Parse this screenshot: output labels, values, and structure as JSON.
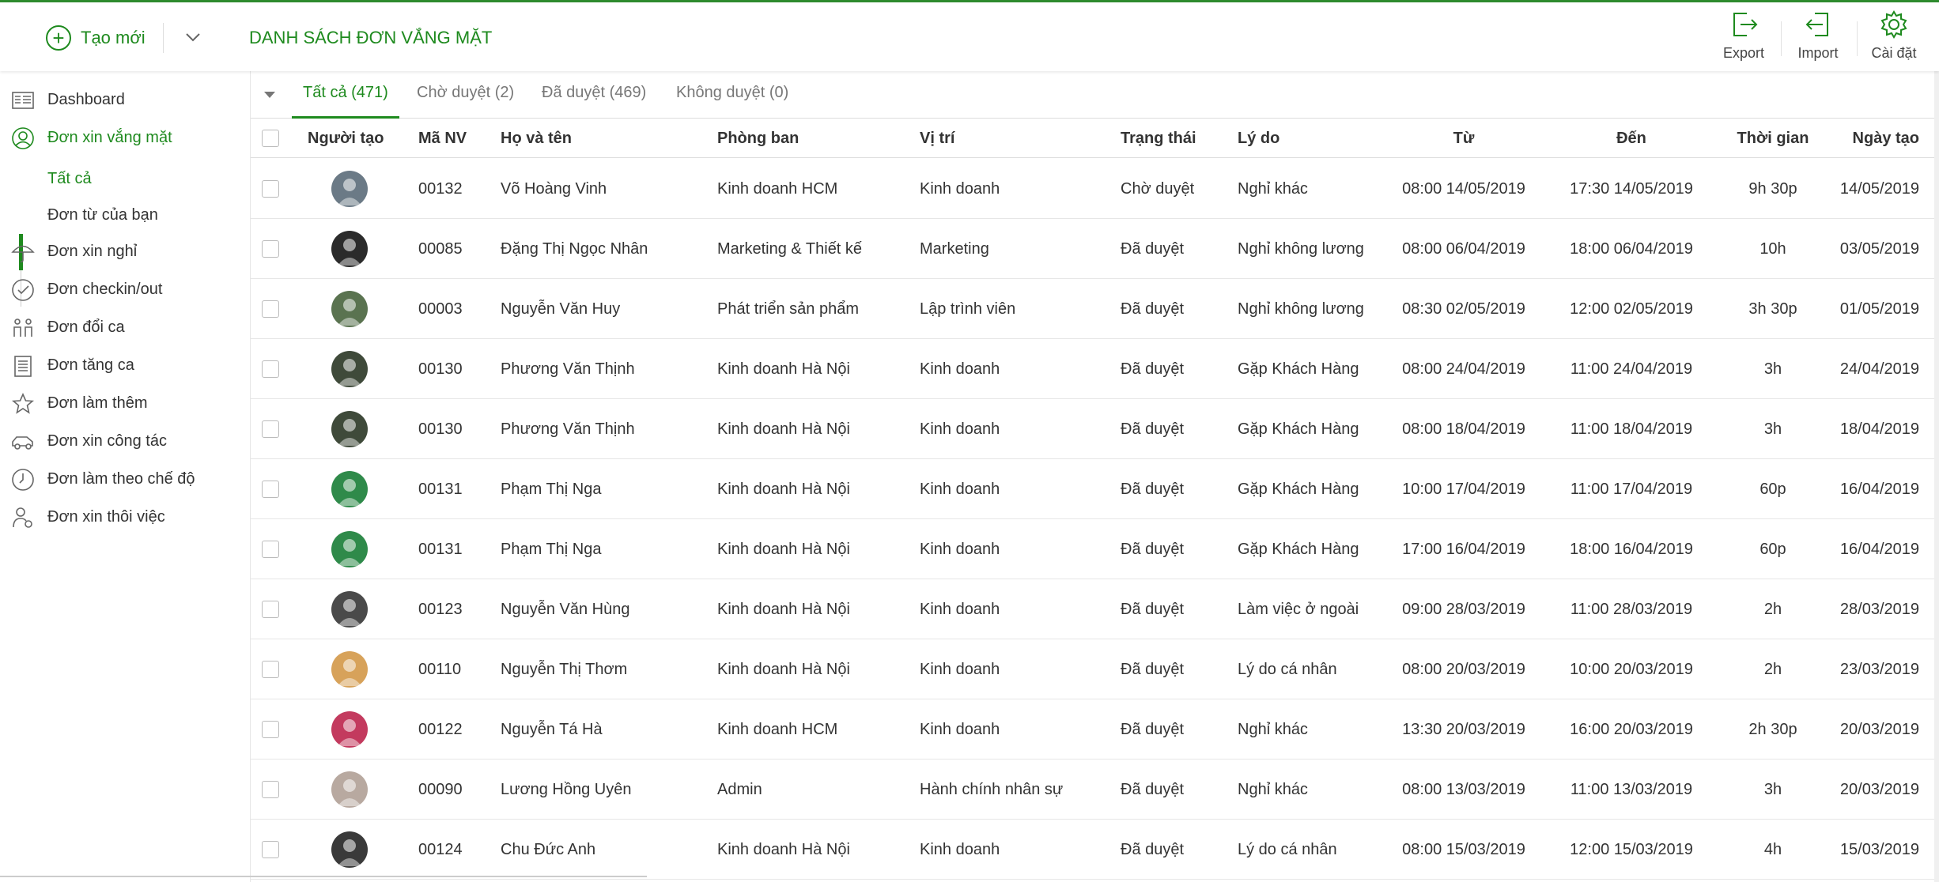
{
  "header": {
    "create_label": "Tạo mới",
    "title": "DANH SÁCH ĐƠN VẮNG MẶT",
    "export_label": "Export",
    "import_label": "Import",
    "settings_label": "Cài đặt",
    "accent_color": "#1e8a1e"
  },
  "sidebar": {
    "items": [
      {
        "label": "Dashboard",
        "icon": "dashboard-icon"
      },
      {
        "label": "Đơn xin vắng mặt",
        "icon": "user-circle-icon",
        "active": true
      },
      {
        "label": "Đơn xin nghỉ",
        "icon": "umbrella-icon"
      },
      {
        "label": "Đơn checkin/out",
        "icon": "check-circle-icon"
      },
      {
        "label": "Đơn đổi ca",
        "icon": "people-swap-icon"
      },
      {
        "label": "Đơn tăng ca",
        "icon": "list-document-icon"
      },
      {
        "label": "Đơn làm thêm",
        "icon": "star-icon"
      },
      {
        "label": "Đơn xin công tác",
        "icon": "car-icon"
      },
      {
        "label": "Đơn làm theo chế độ",
        "icon": "clock-icon"
      },
      {
        "label": "Đơn xin thôi việc",
        "icon": "user-leave-icon"
      }
    ],
    "sub_items": [
      {
        "label": "Tất cả",
        "active": true
      },
      {
        "label": "Đơn từ của bạn"
      }
    ]
  },
  "tabs": [
    {
      "label": "Tất cả (471)",
      "active": true
    },
    {
      "label": "Chờ duyệt (2)"
    },
    {
      "label": "Đã duyệt (469)"
    },
    {
      "label": "Không duyệt (0)"
    }
  ],
  "table": {
    "columns": [
      "Người tạo",
      "Mã NV",
      "Họ và tên",
      "Phòng ban",
      "Vị trí",
      "Trạng thái",
      "Lý do",
      "Từ",
      "Đến",
      "Thời gian",
      "Ngày tạo"
    ],
    "rows": [
      {
        "avatar_color": "#6b7a86",
        "code": "00132",
        "name": "Võ Hoàng Vinh",
        "dept": "Kinh doanh HCM",
        "position": "Kinh doanh",
        "status": "Chờ duyệt",
        "reason": "Nghỉ khác",
        "from": "08:00 14/05/2019",
        "to": "17:30 14/05/2019",
        "duration": "9h 30p",
        "created": "14/05/2019"
      },
      {
        "avatar_color": "#2b2b2b",
        "code": "00085",
        "name": "Đặng Thị Ngọc Nhân",
        "dept": "Marketing & Thiết kế",
        "position": "Marketing",
        "status": "Đã duyệt",
        "reason": "Nghỉ không lương",
        "from": "08:00 06/04/2019",
        "to": "18:00 06/04/2019",
        "duration": "10h",
        "created": "03/05/2019"
      },
      {
        "avatar_color": "#5a7350",
        "code": "00003",
        "name": "Nguyễn Văn Huy",
        "dept": "Phát triển sản phẩm",
        "position": "Lập trình viên",
        "status": "Đã duyệt",
        "reason": "Nghỉ không lương",
        "from": "08:30 02/05/2019",
        "to": "12:00 02/05/2019",
        "duration": "3h 30p",
        "created": "01/05/2019"
      },
      {
        "avatar_color": "#3f4a3a",
        "code": "00130",
        "name": "Phương Văn Thịnh",
        "dept": "Kinh doanh Hà Nội",
        "position": "Kinh doanh",
        "status": "Đã duyệt",
        "reason": "Gặp Khách Hàng",
        "from": "08:00 24/04/2019",
        "to": "11:00 24/04/2019",
        "duration": "3h",
        "created": "24/04/2019"
      },
      {
        "avatar_color": "#3f4a3a",
        "code": "00130",
        "name": "Phương Văn Thịnh",
        "dept": "Kinh doanh Hà Nội",
        "position": "Kinh doanh",
        "status": "Đã duyệt",
        "reason": "Gặp Khách Hàng",
        "from": "08:00 18/04/2019",
        "to": "11:00 18/04/2019",
        "duration": "3h",
        "created": "18/04/2019"
      },
      {
        "avatar_color": "#2f8a4a",
        "code": "00131",
        "name": "Phạm Thị Nga",
        "dept": "Kinh doanh Hà Nội",
        "position": "Kinh doanh",
        "status": "Đã duyệt",
        "reason": "Gặp Khách Hàng",
        "from": "10:00 17/04/2019",
        "to": "11:00 17/04/2019",
        "duration": "60p",
        "created": "16/04/2019"
      },
      {
        "avatar_color": "#2f8a4a",
        "code": "00131",
        "name": "Phạm Thị Nga",
        "dept": "Kinh doanh Hà Nội",
        "position": "Kinh doanh",
        "status": "Đã duyệt",
        "reason": "Gặp Khách Hàng",
        "from": "17:00 16/04/2019",
        "to": "18:00 16/04/2019",
        "duration": "60p",
        "created": "16/04/2019"
      },
      {
        "avatar_color": "#4a4a4a",
        "code": "00123",
        "name": "Nguyễn Văn Hùng",
        "dept": "Kinh doanh Hà Nội",
        "position": "Kinh doanh",
        "status": "Đã duyệt",
        "reason": "Làm việc ở ngoài",
        "from": "09:00 28/03/2019",
        "to": "11:00 28/03/2019",
        "duration": "2h",
        "created": "28/03/2019"
      },
      {
        "avatar_color": "#d7a25a",
        "code": "00110",
        "name": "Nguyễn Thị Thơm",
        "dept": "Kinh doanh Hà Nội",
        "position": "Kinh doanh",
        "status": "Đã duyệt",
        "reason": "Lý do cá nhân",
        "from": "08:00 20/03/2019",
        "to": "10:00 20/03/2019",
        "duration": "2h",
        "created": "23/03/2019"
      },
      {
        "avatar_color": "#c33a5e",
        "code": "00122",
        "name": "Nguyễn Tá Hà",
        "dept": "Kinh doanh HCM",
        "position": "Kinh doanh",
        "status": "Đã duyệt",
        "reason": "Nghỉ khác",
        "from": "13:30 20/03/2019",
        "to": "16:00 20/03/2019",
        "duration": "2h 30p",
        "created": "20/03/2019"
      },
      {
        "avatar_color": "#b8a9a0",
        "code": "00090",
        "name": "Lương Hồng Uyên",
        "dept": "Admin",
        "position": "Hành chính nhân sự",
        "status": "Đã duyệt",
        "reason": "Nghỉ khác",
        "from": "08:00 13/03/2019",
        "to": "11:00 13/03/2019",
        "duration": "3h",
        "created": "20/03/2019"
      },
      {
        "avatar_color": "#3a3a3a",
        "code": "00124",
        "name": "Chu Đức Anh",
        "dept": "Kinh doanh Hà Nội",
        "position": "Kinh doanh",
        "status": "Đã duyệt",
        "reason": "Lý do cá nhân",
        "from": "08:00 15/03/2019",
        "to": "12:00 15/03/2019",
        "duration": "4h",
        "created": "15/03/2019"
      }
    ]
  }
}
